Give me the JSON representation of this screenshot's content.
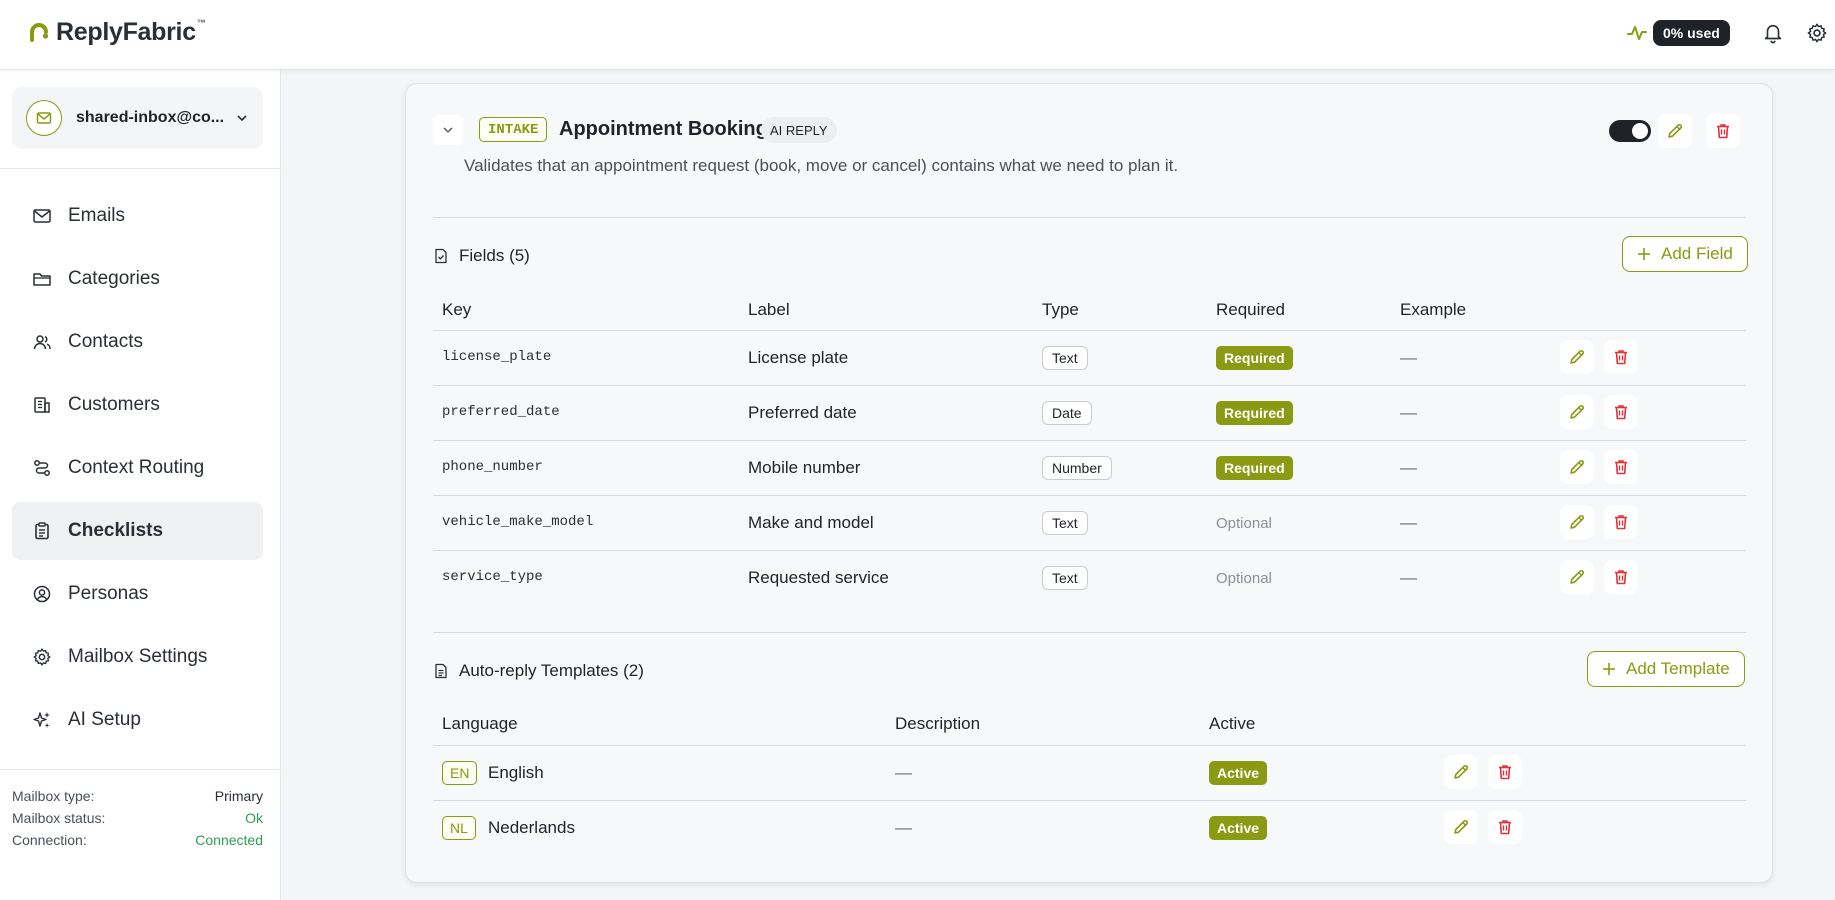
{
  "app": {
    "name": "ReplyFabric",
    "trademark": "™"
  },
  "topbar": {
    "usage": "0% used"
  },
  "sidebar": {
    "mailbox": "shared-inbox@co...",
    "nav": [
      {
        "label": "Emails",
        "icon": "mail-icon"
      },
      {
        "label": "Categories",
        "icon": "folder-icon"
      },
      {
        "label": "Contacts",
        "icon": "users-icon"
      },
      {
        "label": "Customers",
        "icon": "building-icon"
      },
      {
        "label": "Context Routing",
        "icon": "route-icon"
      },
      {
        "label": "Checklists",
        "icon": "clipboard-icon",
        "active": true
      },
      {
        "label": "Personas",
        "icon": "user-circle-icon"
      },
      {
        "label": "Mailbox Settings",
        "icon": "gear-icon"
      },
      {
        "label": "AI Setup",
        "icon": "sparkles-icon"
      }
    ],
    "meta": [
      {
        "key": "Mailbox type:",
        "value": "Primary"
      },
      {
        "key": "Mailbox status:",
        "value": "Ok"
      },
      {
        "key": "Connection:",
        "value": "Connected"
      }
    ]
  },
  "checklist": {
    "badge": "INTAKE",
    "title": "Appointment Booking",
    "mode": "AI REPLY",
    "description": "Validates that an appointment request (book, move or cancel) contains what we need to plan it.",
    "enabled": true
  },
  "fields": {
    "heading": "Fields (5)",
    "add_label": "Add Field",
    "columns": [
      "Key",
      "Label",
      "Type",
      "Required",
      "Example"
    ],
    "rows": [
      {
        "key": "license_plate",
        "label": "License plate",
        "type": "Text",
        "required": "Required",
        "example": "—"
      },
      {
        "key": "preferred_date",
        "label": "Preferred date",
        "type": "Date",
        "required": "Required",
        "example": "—"
      },
      {
        "key": "phone_number",
        "label": "Mobile number",
        "type": "Number",
        "required": "Required",
        "example": "—"
      },
      {
        "key": "vehicle_make_model",
        "label": "Make and model",
        "type": "Text",
        "required": "Optional",
        "example": "—"
      },
      {
        "key": "service_type",
        "label": "Requested service",
        "type": "Text",
        "required": "Optional",
        "example": "—"
      }
    ]
  },
  "templates": {
    "heading": "Auto-reply Templates (2)",
    "add_label": "Add Template",
    "columns": [
      "Language",
      "Description",
      "Active"
    ],
    "rows": [
      {
        "code": "EN",
        "language": "English",
        "description": "—",
        "active": "Active"
      },
      {
        "code": "NL",
        "language": "Nederlands",
        "description": "—",
        "active": "Active"
      }
    ]
  },
  "colors": {
    "accent": "#8a9a12",
    "danger": "#e0323a",
    "success": "#2f9d54",
    "dark": "#1f2328"
  }
}
